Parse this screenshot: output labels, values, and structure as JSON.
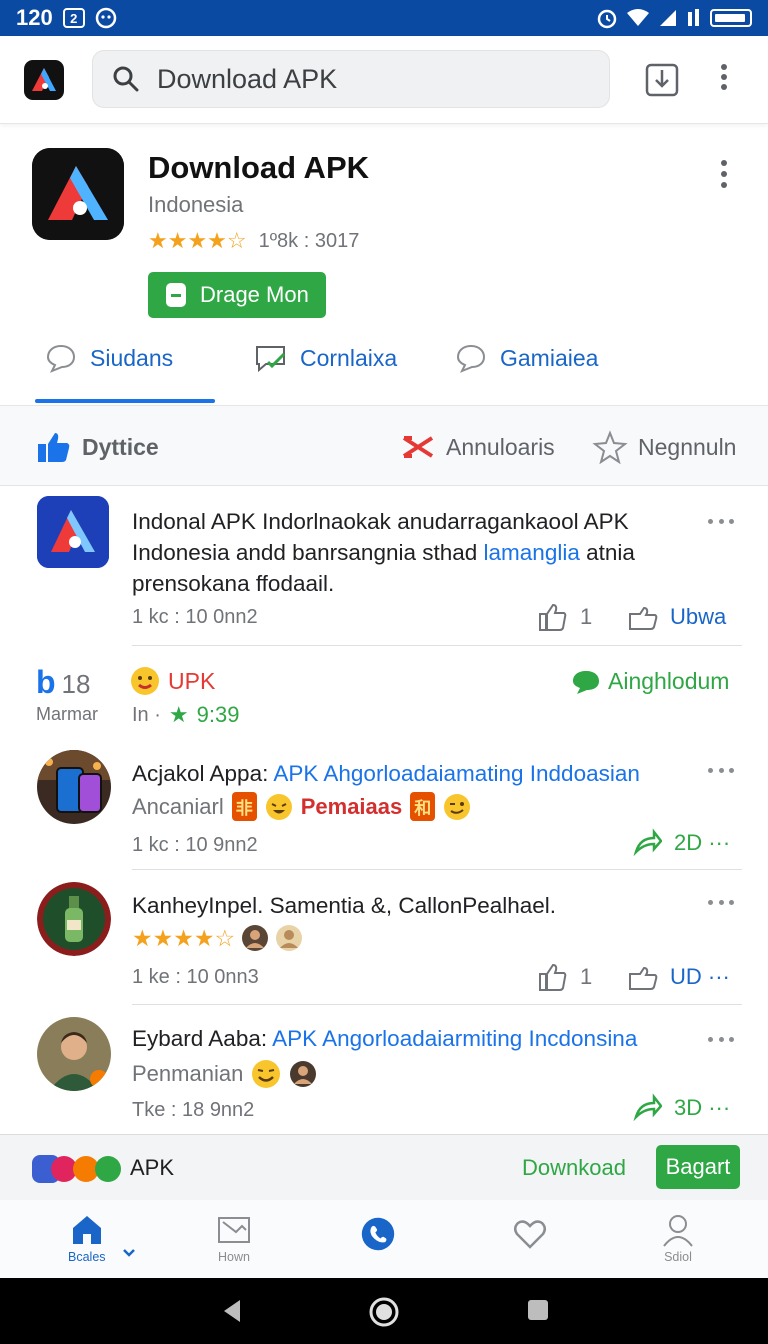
{
  "status_bar": {
    "time": "120",
    "left_box": "2"
  },
  "search": {
    "placeholder": "Download APK"
  },
  "app": {
    "title": "Download APK",
    "region": "Indonesia",
    "stars": "★★★★☆",
    "rating_text": "1º8k : 3017",
    "install_label": "Drage Mon"
  },
  "tabs": [
    {
      "label": "Siudans"
    },
    {
      "label": "Cornlaixa"
    },
    {
      "label": "Gamiaiea"
    }
  ],
  "filters": [
    {
      "label": "Dyttice"
    },
    {
      "label": "Annuloaris"
    },
    {
      "label": "Negnnuln"
    }
  ],
  "posts": [
    {
      "text_before": "Indonal APK Indorlnaokak anudarragankaool APK Indonesia andd banrsangnia sthad ",
      "text_link": "lamanglia",
      "text_after": " atnia prensokana ffodaail.",
      "meta": "1 kc : 10  0nn2",
      "likes": "1",
      "share": "Ubwa"
    },
    {
      "author": "Acjakol Appa: ",
      "link": "APK Ahgorloadaiamating Inddoasian",
      "sub": "Ancaniarl",
      "badge1": "非",
      "highlight": "Pemaiaas",
      "badge2": "和",
      "meta": "1 kc : 10  9nn2",
      "share": "2D ···"
    },
    {
      "author": "KanheyInpel. Samentia  &, CallonPealhael.",
      "stars": "★★★★☆",
      "meta": "1 ke : 10  0nn3",
      "likes": "1",
      "share": "UD ···"
    },
    {
      "author": "Eybard Aaba: ",
      "link": "APK Angorloadaiarmiting Incdonsina",
      "sub": "Penmanian",
      "meta": "Tke : 18  9nn2",
      "share": "3D ···"
    }
  ],
  "stats": {
    "count_prefix": "b",
    "count": "18",
    "count_label": "Marmar",
    "upk_label": "UPK",
    "upk_sub": "In ·",
    "upk_time": "9:39",
    "right_label": "Ainghlodum"
  },
  "banner": {
    "apk": "APK",
    "download": "Downkoad",
    "cta": "Bagart"
  },
  "bottom_nav": [
    {
      "label": "Bcales"
    },
    {
      "label": "Hown"
    },
    {
      "label": ""
    },
    {
      "label": ""
    },
    {
      "label": "Sdiol"
    }
  ],
  "colors": {
    "primary": "#1a73e8",
    "green": "#2fa745",
    "status_bar": "#0b4aa2",
    "star": "#f4a21e"
  }
}
